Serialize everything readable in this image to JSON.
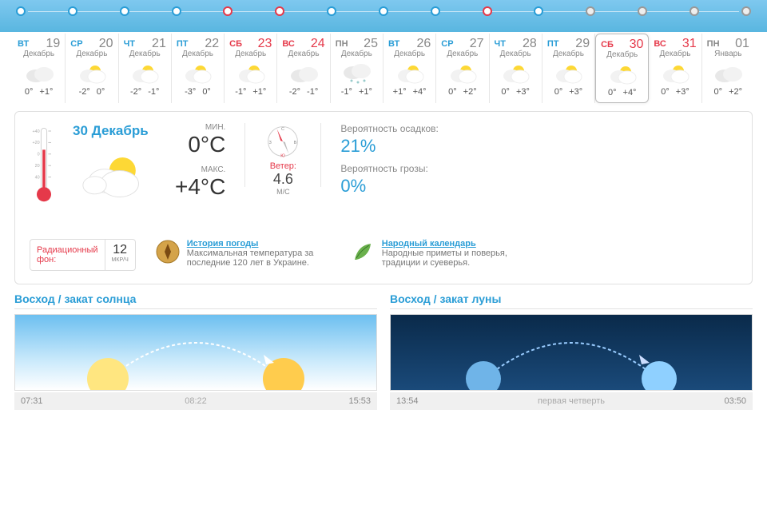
{
  "timeline_dots": [
    {
      "cls": ""
    },
    {
      "cls": ""
    },
    {
      "cls": ""
    },
    {
      "cls": ""
    },
    {
      "cls": "red"
    },
    {
      "cls": "red"
    },
    {
      "cls": ""
    },
    {
      "cls": ""
    },
    {
      "cls": ""
    },
    {
      "cls": "red"
    },
    {
      "cls": ""
    },
    {
      "cls": "gray"
    },
    {
      "cls": "gray"
    },
    {
      "cls": "gray"
    },
    {
      "cls": "gray"
    }
  ],
  "days": [
    {
      "dow": "ВТ",
      "dowc": "blue",
      "num": "19",
      "numc": "",
      "month": "Декабрь",
      "icon": "cloud",
      "lo": "0°",
      "hi": "+1°",
      "sel": false
    },
    {
      "dow": "СР",
      "dowc": "blue",
      "num": "20",
      "numc": "",
      "month": "Декабрь",
      "icon": "psun",
      "lo": "-2°",
      "hi": "0°",
      "sel": false
    },
    {
      "dow": "ЧТ",
      "dowc": "blue",
      "num": "21",
      "numc": "",
      "month": "Декабрь",
      "icon": "psun",
      "lo": "-2°",
      "hi": "-1°",
      "sel": false
    },
    {
      "dow": "ПТ",
      "dowc": "blue",
      "num": "22",
      "numc": "",
      "month": "Декабрь",
      "icon": "psun",
      "lo": "-3°",
      "hi": "0°",
      "sel": false
    },
    {
      "dow": "СБ",
      "dowc": "red",
      "num": "23",
      "numc": "red",
      "month": "Декабрь",
      "icon": "psun",
      "lo": "-1°",
      "hi": "+1°",
      "sel": false
    },
    {
      "dow": "ВС",
      "dowc": "red",
      "num": "24",
      "numc": "red",
      "month": "Декабрь",
      "icon": "cloud",
      "lo": "-2°",
      "hi": "-1°",
      "sel": false
    },
    {
      "dow": "ПН",
      "dowc": "gray",
      "num": "25",
      "numc": "",
      "month": "Декабрь",
      "icon": "snow",
      "lo": "-1°",
      "hi": "+1°",
      "sel": false
    },
    {
      "dow": "ВТ",
      "dowc": "blue",
      "num": "26",
      "numc": "",
      "month": "Декабрь",
      "icon": "psun",
      "lo": "+1°",
      "hi": "+4°",
      "sel": false
    },
    {
      "dow": "СР",
      "dowc": "blue",
      "num": "27",
      "numc": "",
      "month": "Декабрь",
      "icon": "psun",
      "lo": "0°",
      "hi": "+2°",
      "sel": false
    },
    {
      "dow": "ЧТ",
      "dowc": "blue",
      "num": "28",
      "numc": "",
      "month": "Декабрь",
      "icon": "psun",
      "lo": "0°",
      "hi": "+3°",
      "sel": false
    },
    {
      "dow": "ПТ",
      "dowc": "blue",
      "num": "29",
      "numc": "",
      "month": "Декабрь",
      "icon": "psun",
      "lo": "0°",
      "hi": "+3°",
      "sel": false
    },
    {
      "dow": "СБ",
      "dowc": "red",
      "num": "30",
      "numc": "red",
      "month": "Декабрь",
      "icon": "psun",
      "lo": "0°",
      "hi": "+4°",
      "sel": true
    },
    {
      "dow": "ВС",
      "dowc": "red",
      "num": "31",
      "numc": "red",
      "month": "Декабрь",
      "icon": "psun",
      "lo": "0°",
      "hi": "+3°",
      "sel": false
    },
    {
      "dow": "ПН",
      "dowc": "gray",
      "num": "01",
      "numc": "",
      "month": "Январь",
      "icon": "cloud",
      "lo": "0°",
      "hi": "+2°",
      "sel": false
    }
  ],
  "detail": {
    "date": "30 Декабрь",
    "min_lbl": "МИН.",
    "min": "0°C",
    "max_lbl": "МАКС.",
    "max": "+4°C",
    "wind_lbl": "Ветер:",
    "wind_v": "4.6",
    "wind_u": "М/С",
    "precip_lbl": "Вероятность осадков:",
    "precip_v": "21%",
    "storm_lbl": "Вероятность грозы:",
    "storm_v": "0%"
  },
  "rad": {
    "lbl": "Радиационный\nфон:",
    "v": "12",
    "u": "МКР/Ч"
  },
  "history": {
    "title": "История погоды",
    "desc": "Максимальная температура за последние 120 лет в Украине."
  },
  "folk": {
    "title": "Народный календарь",
    "desc": "Народные приметы и поверья, традиции и суеверья."
  },
  "sun": {
    "title": "Восход / закат солнца",
    "rise": "07:31",
    "dur": "08:22",
    "set": "15:53"
  },
  "moon": {
    "title": "Восход / закат луны",
    "rise": "13:54",
    "phase": "первая четверть",
    "set": "03:50"
  }
}
